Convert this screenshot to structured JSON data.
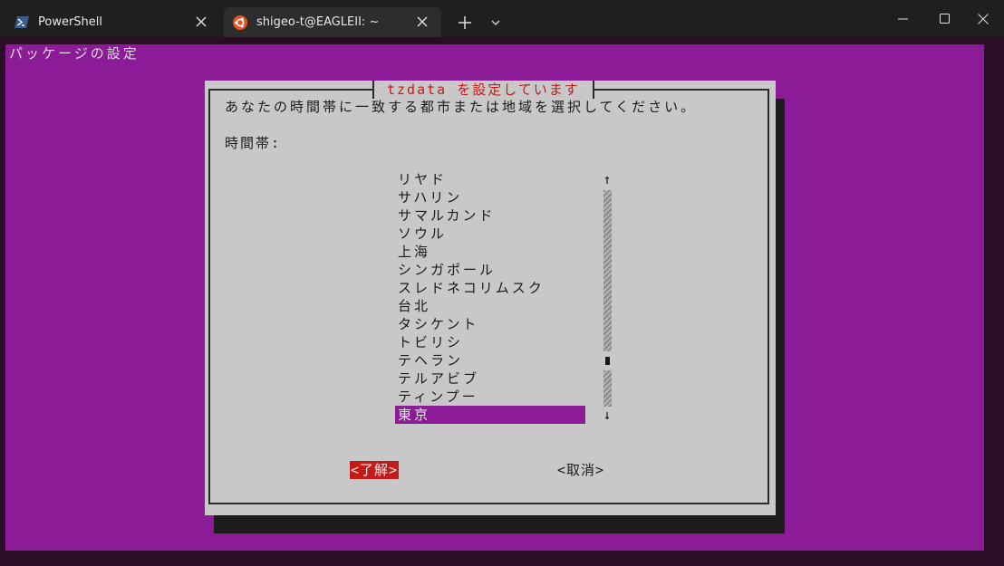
{
  "tabs": [
    {
      "label": "PowerShell",
      "icon": "powershell-icon"
    },
    {
      "label": "shigeo-t@EAGLEII: ~",
      "icon": "ubuntu-icon"
    }
  ],
  "terminal": {
    "heading": "パッケージの設定",
    "background_color": "#8b1b96"
  },
  "dialog": {
    "title": "tzdata を設定しています",
    "prompt": "あなたの時間帯に一致する都市または地域を選択してください。",
    "field_label": "時間帯:",
    "items": [
      "リヤド",
      "サハリン",
      "サマルカンド",
      "ソウル",
      "上海",
      "シンガポール",
      "スレドネコリムスク",
      "台北",
      "タシケント",
      "トビリシ",
      "テヘラン",
      "テルアビブ",
      "ティンプー",
      "東京"
    ],
    "selected": "東京",
    "scroll_up": "↑",
    "scroll_down": "↓",
    "ok_label": "<了解>",
    "cancel_label": "<取消>",
    "accent_color": "#c41a1a"
  }
}
